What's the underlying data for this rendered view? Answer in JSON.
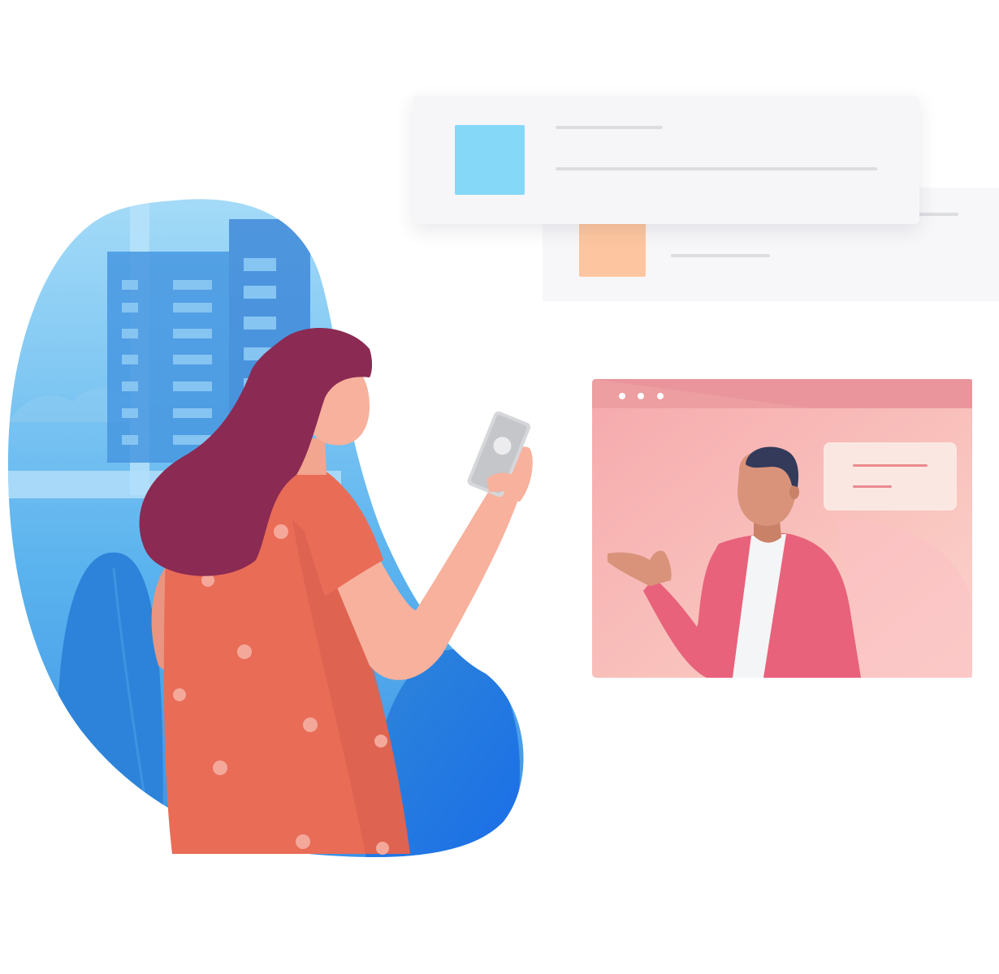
{
  "illustration": {
    "colors": {
      "background": "#ffffff",
      "blob_blue": "#3d8fe0",
      "blob_light": "#9fd3f5",
      "hair": "#8b2a52",
      "skin_woman": "#f7b19c",
      "dress": "#e96c57",
      "dress_dots": "#f4a89a",
      "card_thumb_blue": "#85d8f8",
      "card_thumb_orange": "#fdc6a0",
      "video_bg": "#f7b9b6",
      "video_bar": "#e88f98",
      "jacket": "#e8627b",
      "skin_man": "#d9937b",
      "hair_man": "#333a5a"
    },
    "icons": [
      "window-dots-icon",
      "phone-card-icon"
    ]
  }
}
